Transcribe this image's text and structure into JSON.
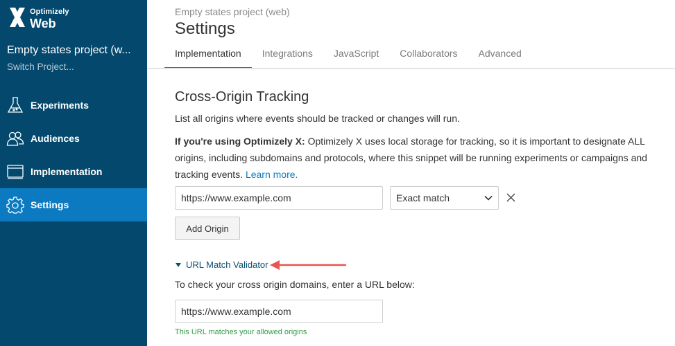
{
  "sidebar": {
    "logo_top": "Optimizely",
    "logo_bottom": "Web",
    "project_name": "Empty states project (w...",
    "switch_project": "Switch Project...",
    "items": [
      {
        "label": "Experiments",
        "icon": "flask-icon"
      },
      {
        "label": "Audiences",
        "icon": "people-icon"
      },
      {
        "label": "Implementation",
        "icon": "window-icon"
      },
      {
        "label": "Settings",
        "icon": "gear-icon",
        "active": true
      }
    ],
    "bg_color": "#04496d",
    "active_color": "#0c7ac0"
  },
  "header": {
    "breadcrumb": "Empty states project (web)",
    "title": "Settings",
    "tabs": [
      {
        "label": "Implementation",
        "active": true
      },
      {
        "label": "Integrations"
      },
      {
        "label": "JavaScript"
      },
      {
        "label": "Collaborators"
      },
      {
        "label": "Advanced"
      }
    ]
  },
  "main": {
    "section_title": "Cross-Origin Tracking",
    "description": "List all origins where events should be tracked or changes will run.",
    "note_bold": "If you're using Optimizely X:",
    "note_text": " Optimizely X uses local storage for tracking, so it is important to designate ALL origins, including subdomains and protocols, where this snippet will be running experiments or campaigns and tracking events.",
    "learn_more": "Learn more.",
    "origin_value": "https://www.example.com",
    "match_type": "Exact match",
    "add_origin": "Add Origin",
    "validator_label": "URL Match Validator",
    "check_text": "To check your cross origin domains, enter a URL below:",
    "url_value": "https://www.example.com",
    "match_result": "This URL matches your allowed origins",
    "annotation_arrow_color": "#e8574f",
    "success_color": "#2e9a44"
  }
}
